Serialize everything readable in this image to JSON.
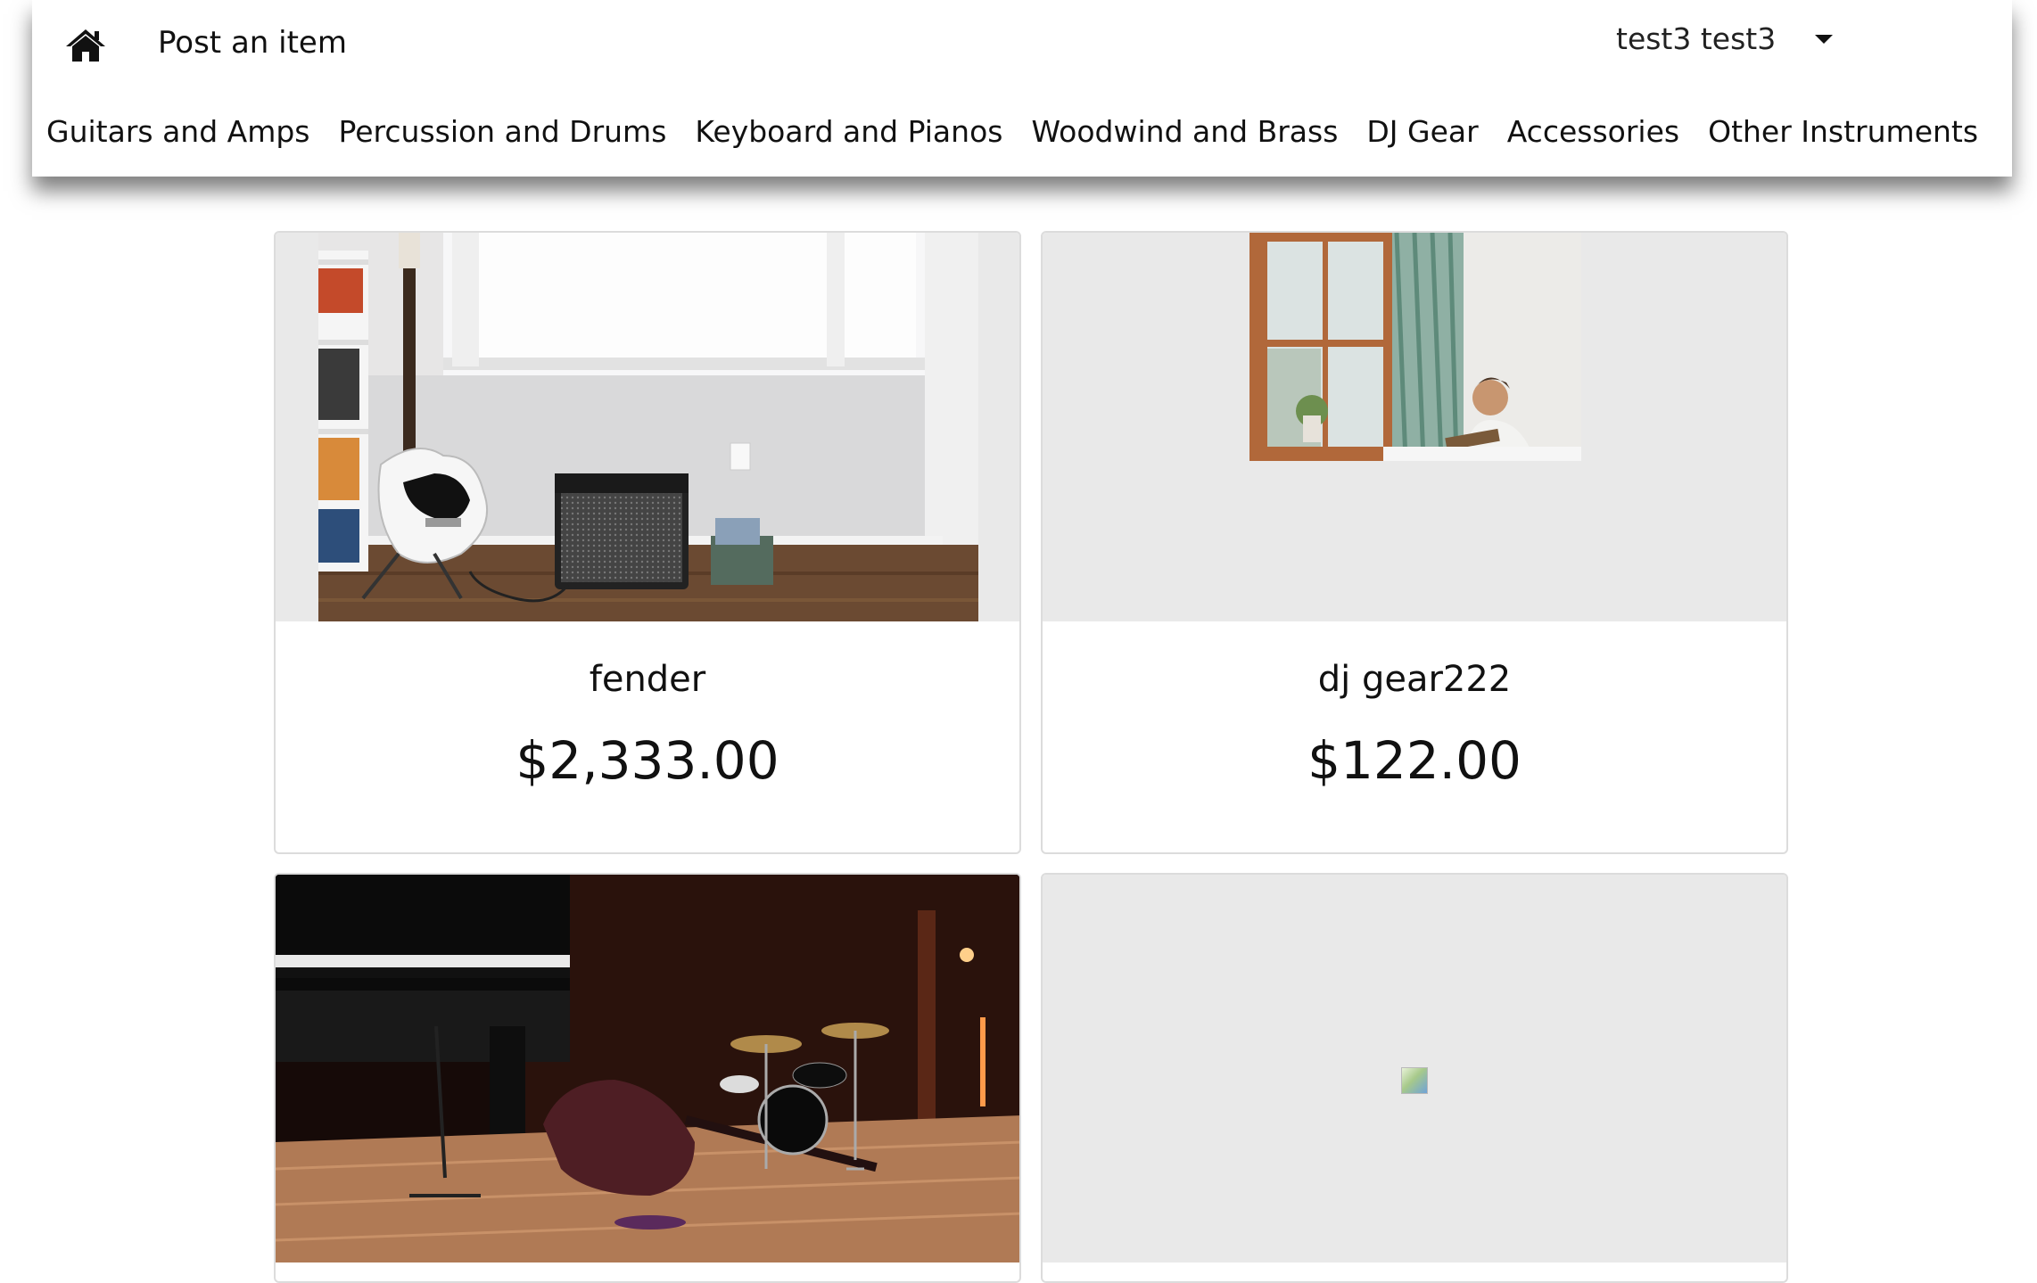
{
  "navbar": {
    "home_icon": "home-icon",
    "post_item_label": "Post an item",
    "user_name": "test3 test3",
    "dropdown_icon": "caret-down-icon",
    "categories": [
      "Guitars and Amps",
      "Percussion and Drums",
      "Keyboard and Pianos",
      "Woodwind and Brass",
      "DJ Gear",
      "Accessories",
      "Other Instruments"
    ]
  },
  "listings": [
    {
      "title": "fender",
      "price": "$2,333.00",
      "image": "bass guitar and amplifier in room"
    },
    {
      "title": "dj gear222",
      "price": "$122.00",
      "image": "man playing guitar by window"
    },
    {
      "title": "",
      "price": "",
      "image": "piano, double bass and drum kit on stage"
    },
    {
      "title": "",
      "price": "",
      "image": "broken image"
    }
  ],
  "colors": {
    "card_image_bg": "#e9e9e9",
    "card_border": "#dcdcdc",
    "text": "#111111"
  }
}
